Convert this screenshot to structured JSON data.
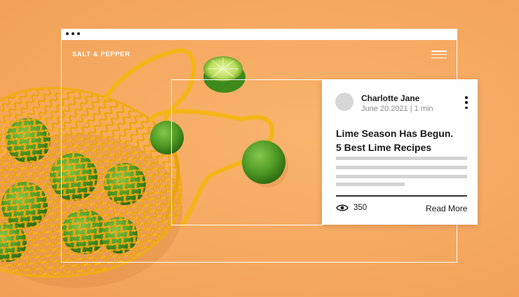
{
  "site": {
    "brand": "SALT & PEPPER"
  },
  "post": {
    "author": "Charlotte Jane",
    "date": "June 20.2021",
    "separator": "|",
    "read_time": "1 min",
    "title_line1": "Lime Season Has Begun.",
    "title_line2": "5 Best Lime Recipes",
    "views": "350",
    "read_more": "Read More"
  },
  "icons": {
    "window_dots": "window-dots-icon",
    "menu": "hamburger-menu-icon",
    "more": "more-options-icon",
    "views": "eye-icon"
  },
  "colors": {
    "background": "#f5a860",
    "net_bag": "#f4b516",
    "lime": "#5a9e2a",
    "card": "#ffffff",
    "text": "#1a1a1a",
    "muted": "#8a8a8a"
  }
}
